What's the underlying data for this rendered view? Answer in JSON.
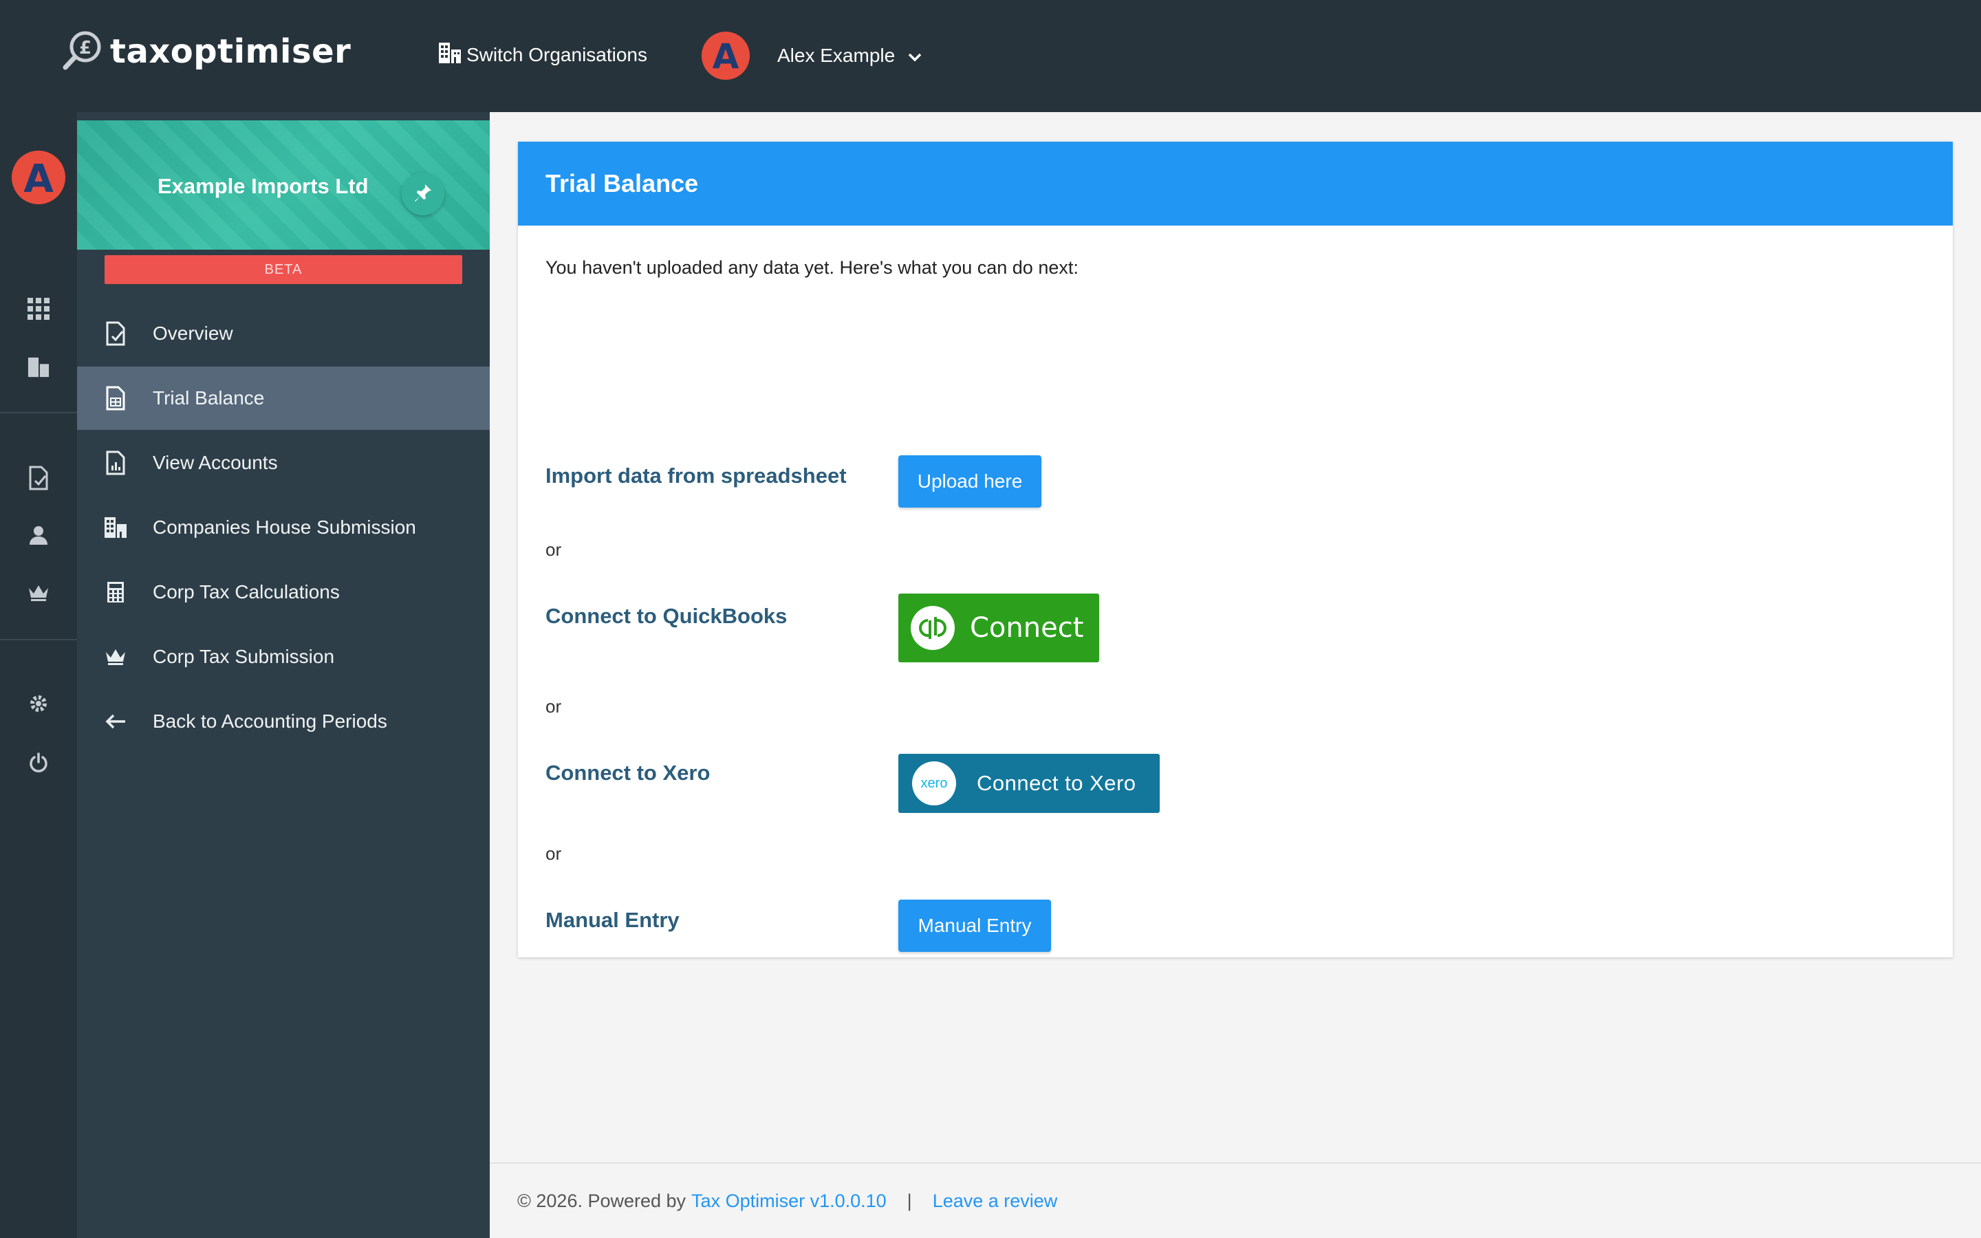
{
  "app": {
    "logo_text": "taxoptimiser",
    "logo_icon": "pound-magnifier-icon"
  },
  "topbar": {
    "switch_org_label": "Switch Organisations",
    "user_name": "Alex Example",
    "user_avatar_letter": "A"
  },
  "rail": {
    "icons": [
      "apps-grid-icon",
      "building-icon",
      "document-check-icon",
      "person-icon",
      "crown-icon",
      "gear-icon",
      "power-icon"
    ]
  },
  "sidebar": {
    "org_name": "Example Imports Ltd",
    "badge": "BETA",
    "items": [
      {
        "label": "Overview",
        "icon": "document-check-icon",
        "active": false
      },
      {
        "label": "Trial Balance",
        "icon": "spreadsheet-icon",
        "active": true
      },
      {
        "label": "View Accounts",
        "icon": "report-chart-icon",
        "active": false
      },
      {
        "label": "Companies House Submission",
        "icon": "building-icon",
        "active": false
      },
      {
        "label": "Corp Tax Calculations",
        "icon": "calculator-icon",
        "active": false
      },
      {
        "label": "Corp Tax Submission",
        "icon": "crown-icon",
        "active": false
      },
      {
        "label": "Back to Accounting Periods",
        "icon": "arrow-left-icon",
        "active": false
      }
    ]
  },
  "main": {
    "card_title": "Trial Balance",
    "intro": "You haven't uploaded any data yet. Here's what you can do next:",
    "or_text": "or",
    "options": {
      "spreadsheet_label": "Import data from spreadsheet",
      "spreadsheet_button": "Upload here",
      "quickbooks_label": "Connect to QuickBooks",
      "quickbooks_button": "Connect",
      "xero_label": "Connect to Xero",
      "xero_button": "Connect to Xero",
      "xero_logo_text": "xero",
      "manual_label": "Manual Entry",
      "manual_button": "Manual Entry"
    }
  },
  "footer": {
    "copyright": "© 2026. Powered by",
    "product_link": "Tax Optimiser v1.0.0.10",
    "separator": "|",
    "review_link": "Leave a review"
  },
  "colors": {
    "topbar_bg": "#27333b",
    "sidebar_bg": "#2e3e48",
    "sidebar_header": "#3cc1a8",
    "active_item": "#56687a",
    "primary": "#2196f3",
    "label_text": "#2c5d7c",
    "beta_badge": "#ef5350",
    "quickbooks_green": "#2ca01c",
    "xero_blue": "#13779c",
    "avatar_red": "#e84c3d"
  }
}
